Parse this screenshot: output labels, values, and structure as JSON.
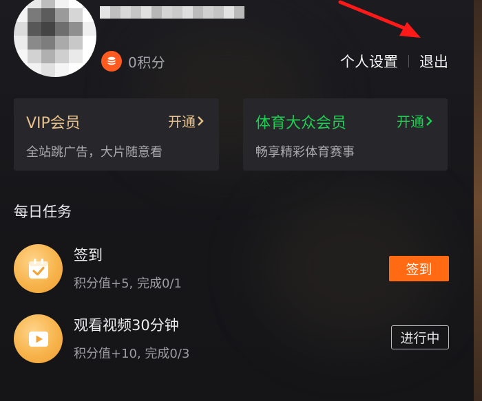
{
  "user": {
    "points_text": "0积分",
    "avatar_colors": [
      "#ffffff",
      "#e8e8e8",
      "#bdbdbd",
      "#f2f2f2",
      "#ffffff",
      "#d9d9d9",
      "#f4f4f4",
      "#7a7a7a",
      "#5c5c5c",
      "#9a9a9a",
      "#d6d6d6",
      "#ffffff",
      "#dcdcdc",
      "#585858",
      "#444444",
      "#6e6e6e",
      "#8f8f8f",
      "#f0f0f0",
      "#ececec",
      "#8a8a8a",
      "#7d7d7d",
      "#aaaaaa",
      "#c8c8c8",
      "#ffffff",
      "#f6f6f6",
      "#d2d2d2",
      "#b0b0b0",
      "#cfcfcf",
      "#eaeaea",
      "#ffffff",
      "#ffffff",
      "#f2f2f2",
      "#e0e0e0",
      "#f5f5f5",
      "#ffffff",
      "#ffffff"
    ],
    "username_mosaic_colors": [
      "#e4e4e4",
      "#bfbfbf",
      "#d8d8d8",
      "#c6c6c6",
      "#e0e0e0",
      "#b7b7b7",
      "#d4d4d4",
      "#cacaca",
      "#dedede",
      "#bcbcbc",
      "#d0d0d0",
      "#c4c4c4",
      "#e2e2e2",
      "#bababa"
    ]
  },
  "header_links": {
    "settings": "个人设置",
    "logout": "退出"
  },
  "cards": {
    "vip": {
      "title": "VIP会员",
      "open": "开通",
      "subtitle": "全站跳广告，大片随意看",
      "accent": "#e7c08b"
    },
    "sport": {
      "title": "体育大众会员",
      "open": "开通",
      "subtitle": "畅享精彩体育赛事",
      "accent": "#1fce53"
    }
  },
  "daily": {
    "title": "每日任务",
    "tasks": [
      {
        "name": "签到",
        "desc": "积分值+5, 完成0/1",
        "button": "签到",
        "icon": "calendar-check-icon"
      },
      {
        "name": "观看视频30分钟",
        "desc": "积分值+10, 完成0/3",
        "button": "进行中",
        "icon": "play-icon"
      }
    ]
  },
  "colors": {
    "sign_button": "#ff6a13",
    "coin": "#ff5a1f",
    "task_icon": "#f7b44c",
    "arrow": "#ff1a1a"
  }
}
